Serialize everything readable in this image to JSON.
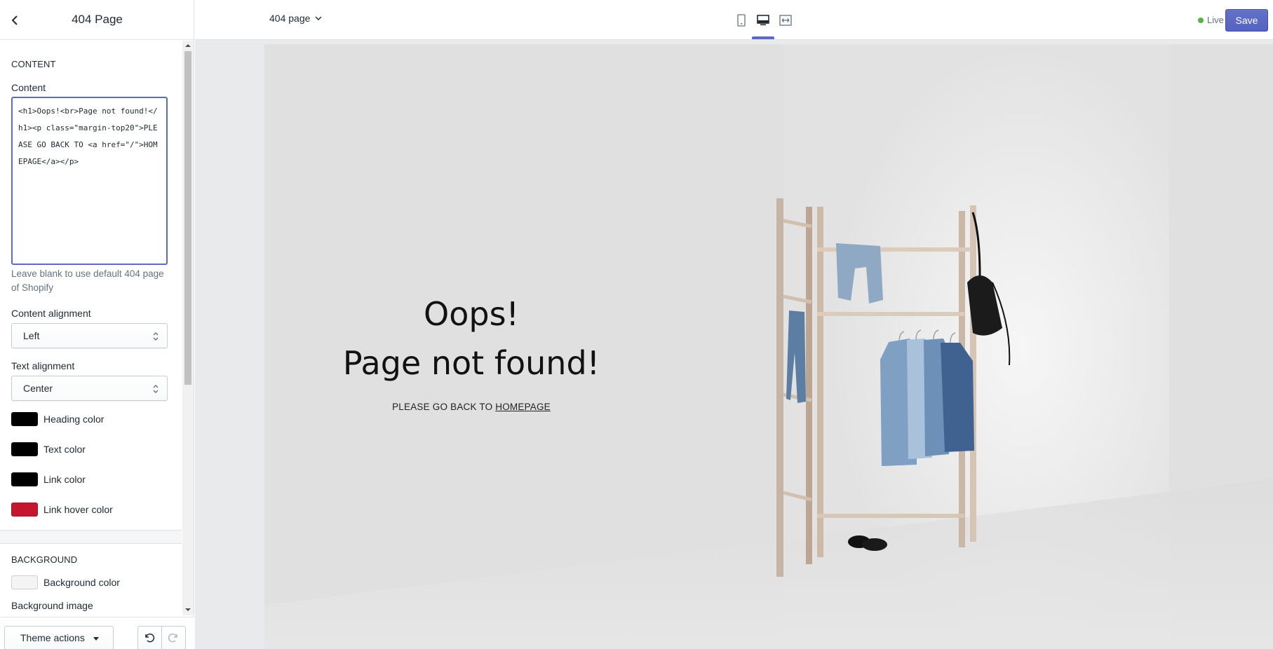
{
  "sidebar": {
    "title": "404 Page",
    "content_section": {
      "section_title": "CONTENT",
      "content_label": "Content",
      "content_value": "<h1>Oops!<br>Page not found!</h1><p class=\"margin-top20\">PLEASE GO BACK TO <a href=\"/\">HOMEPAGE</a></p>",
      "content_help": "Leave blank to use default 404 page of Shopify",
      "content_alignment_label": "Content alignment",
      "content_alignment_value": "Left",
      "text_alignment_label": "Text alignment",
      "text_alignment_value": "Center",
      "colors": [
        {
          "label": "Heading color",
          "value": "#000000"
        },
        {
          "label": "Text color",
          "value": "#000000"
        },
        {
          "label": "Link color",
          "value": "#000000"
        },
        {
          "label": "Link hover color",
          "value": "#c5162e"
        }
      ]
    },
    "background_section": {
      "section_title": "BACKGROUND",
      "background_color_label": "Background color",
      "background_color_value": "#f4f4f4",
      "background_image_label": "Background image"
    },
    "footer": {
      "theme_actions_label": "Theme actions"
    }
  },
  "topbar": {
    "page_select_label": "404 page",
    "devices": [
      "mobile-icon",
      "desktop-icon",
      "fullscreen-icon"
    ],
    "active_device": "desktop",
    "live_label": "Live",
    "save_label": "Save",
    "accent_color": "#5c6ac4"
  },
  "preview": {
    "heading_line1": "Oops!",
    "heading_line2": "Page not found!",
    "back_text": "PLEASE GO BACK TO",
    "link_text": "HOMEPAGE"
  }
}
